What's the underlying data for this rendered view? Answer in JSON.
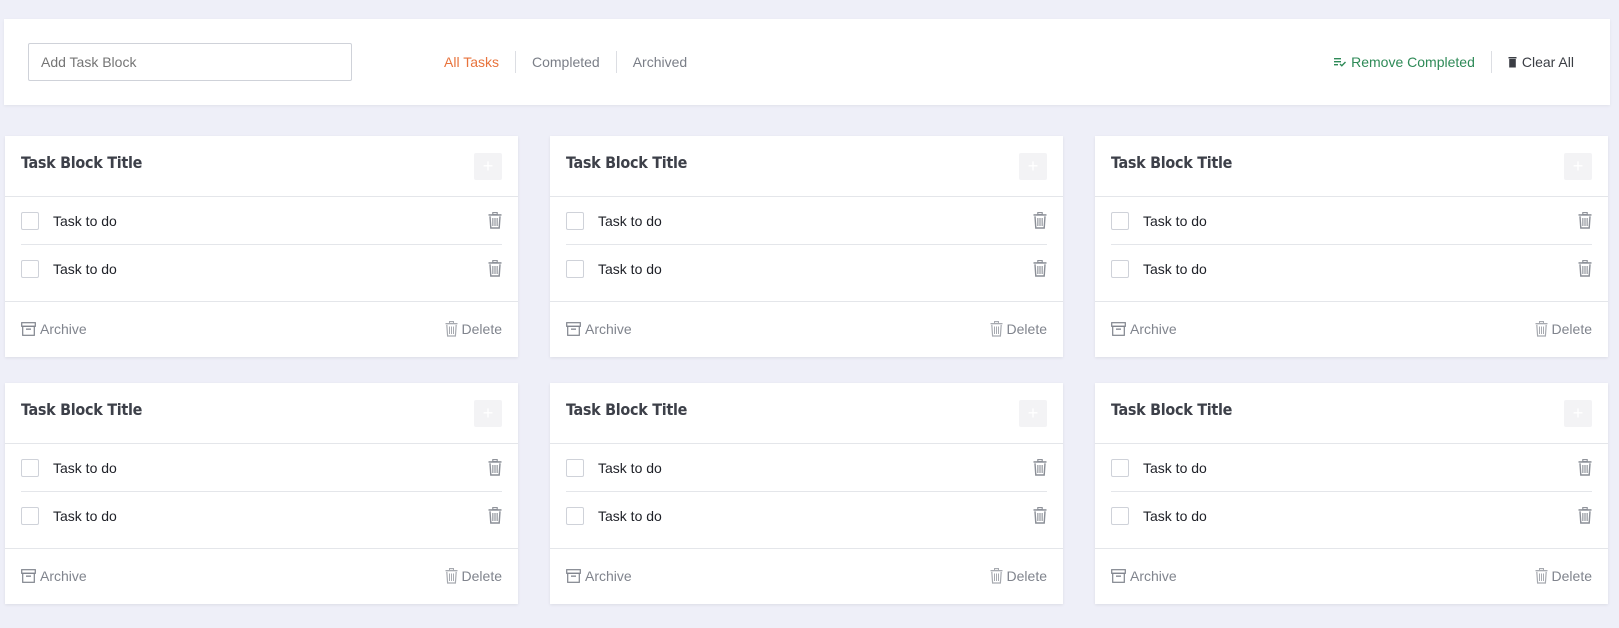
{
  "header": {
    "add_placeholder": "Add Task Block",
    "filters": [
      "All Tasks",
      "Completed",
      "Archived"
    ],
    "active_filter": "All Tasks",
    "remove_completed": "Remove Completed",
    "clear_all": "Clear All"
  },
  "blocks": [
    {
      "title": "Task Block Title",
      "add_icon": "plus-icon",
      "tasks": [
        {
          "text": "Task to do",
          "done": false
        },
        {
          "text": "Task to do",
          "done": false
        }
      ],
      "archive": "Archive",
      "delete": "Delete"
    },
    {
      "title": "Task Block Title",
      "add_icon": "plus-icon",
      "tasks": [
        {
          "text": "Task to do",
          "done": false
        },
        {
          "text": "Task to do",
          "done": false
        }
      ],
      "archive": "Archive",
      "delete": "Delete"
    },
    {
      "title": "Task Block Title",
      "add_icon": "plus-icon",
      "tasks": [
        {
          "text": "Task to do",
          "done": false
        },
        {
          "text": "Task to do",
          "done": false
        }
      ],
      "archive": "Archive",
      "delete": "Delete"
    },
    {
      "title": "Task Block Title",
      "add_icon": "plus-icon",
      "tasks": [
        {
          "text": "Task to do",
          "done": false
        },
        {
          "text": "Task to do",
          "done": false
        }
      ],
      "archive": "Archive",
      "delete": "Delete"
    },
    {
      "title": "Task Block Title",
      "add_icon": "plus-icon",
      "tasks": [
        {
          "text": "Task to do",
          "done": false
        },
        {
          "text": "Task to do",
          "done": false
        }
      ],
      "archive": "Archive",
      "delete": "Delete"
    },
    {
      "title": "Task Block Title",
      "add_icon": "plus-icon",
      "tasks": [
        {
          "text": "Task to do",
          "done": false
        },
        {
          "text": "Task to do",
          "done": false
        }
      ],
      "archive": "Archive",
      "delete": "Delete"
    }
  ],
  "colors": {
    "background": "#eeeff8",
    "active_filter": "#e8733c",
    "remove_completed": "#2e8a57",
    "muted": "#80848d"
  }
}
